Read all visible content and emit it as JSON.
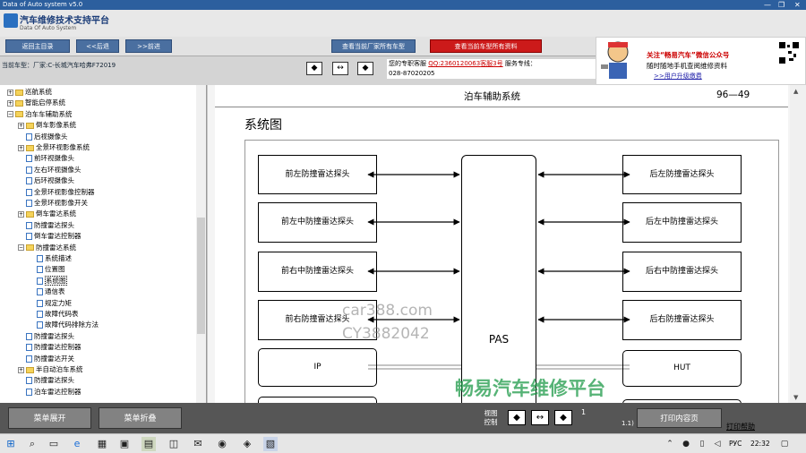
{
  "window": {
    "title": "Data of Auto system v5.0",
    "minimize": "—",
    "maximize": "❐",
    "close": "✕"
  },
  "header": {
    "app_title": "汽车维修技术支持平台",
    "app_subtitle": "Data Of Auto System"
  },
  "toolbar": {
    "back_main": "返回主目录",
    "prev": "<<后退",
    "next": ">>前进",
    "view_manufacturer_models": "查看当前厂家所有车型",
    "view_model_data": "查看当前车型所有资料"
  },
  "vehicle": {
    "label": "当前车型：厂家:C-长城汽车哈弗F72019"
  },
  "contact": {
    "prefix": "您的专职客服",
    "qq": "QQ:2360120063",
    "agent": "客服3号",
    "hotline_label": "服务专线：",
    "hotline": "028-87020205"
  },
  "ad": {
    "line1": "关注“畅易汽车”微信公众号",
    "line2": "随时随地手机查阅维修资料",
    "line3": ">>用户升级缴费"
  },
  "sidebar": {
    "items": [
      {
        "label": "巡航系统",
        "level": 0,
        "kind": "folder-exp"
      },
      {
        "label": "智能启停系统",
        "level": 0,
        "kind": "folder-exp"
      },
      {
        "label": "泊车车辅助系统",
        "level": 0,
        "kind": "folder-col"
      },
      {
        "label": "倒车影像系统",
        "level": 1,
        "kind": "folder-exp"
      },
      {
        "label": "后视摄像头",
        "level": 1,
        "kind": "doc"
      },
      {
        "label": "全景环视影像系统",
        "level": 1,
        "kind": "folder-exp"
      },
      {
        "label": "前环视摄像头",
        "level": 1,
        "kind": "doc"
      },
      {
        "label": "左右环视摄像头",
        "level": 1,
        "kind": "doc"
      },
      {
        "label": "后环视摄像头",
        "level": 1,
        "kind": "doc"
      },
      {
        "label": "全景环视影像控制器",
        "level": 1,
        "kind": "doc"
      },
      {
        "label": "全景环视影像开关",
        "level": 1,
        "kind": "doc"
      },
      {
        "label": "倒车雷达系统",
        "level": 1,
        "kind": "folder-exp"
      },
      {
        "label": "防撞雷达探头",
        "level": 1,
        "kind": "doc"
      },
      {
        "label": "倒车雷达控制器",
        "level": 1,
        "kind": "doc"
      },
      {
        "label": "防撞雷达系统",
        "level": 1,
        "kind": "folder-col"
      },
      {
        "label": "系统描述",
        "level": 2,
        "kind": "doc"
      },
      {
        "label": "位置图",
        "level": 2,
        "kind": "doc"
      },
      {
        "label": "系统图",
        "level": 2,
        "kind": "doc",
        "selected": true
      },
      {
        "label": "通信表",
        "level": 2,
        "kind": "doc"
      },
      {
        "label": "规定力矩",
        "level": 2,
        "kind": "doc"
      },
      {
        "label": "故障代码表",
        "level": 2,
        "kind": "doc"
      },
      {
        "label": "故障代码排除方法",
        "level": 2,
        "kind": "doc"
      },
      {
        "label": "防撞雷达探头",
        "level": 1,
        "kind": "doc"
      },
      {
        "label": "防撞雷达控制器",
        "level": 1,
        "kind": "doc"
      },
      {
        "label": "防撞雷达开关",
        "level": 1,
        "kind": "doc"
      },
      {
        "label": "半自动泊车系统",
        "level": 1,
        "kind": "folder-exp"
      },
      {
        "label": "防撞雷达探头",
        "level": 1,
        "kind": "doc"
      },
      {
        "label": "泊车雷达控制器",
        "level": 1,
        "kind": "doc"
      }
    ]
  },
  "document": {
    "section": "泊车辅助系统",
    "page_ref": "96—49",
    "heading": "系统图",
    "left_sensors": [
      "前左防撞雷达探头",
      "前左中防撞雷达探头",
      "前右中防撞雷达探头",
      "前右防撞雷达探头"
    ],
    "right_sensors": [
      "后左防撞雷达探头",
      "后左中防撞雷达探头",
      "后右中防撞雷达探头",
      "后右防撞雷达探头"
    ],
    "center": "PAS",
    "ip": "IP",
    "hut": "HUT",
    "watermark1": "car388.com",
    "watermark2": "CY3882042",
    "watermark3": "畅易汽车维修平台"
  },
  "bottom": {
    "expand": "菜单展开",
    "collapse": "菜单折叠",
    "view_control": "视图控制",
    "page_num": "1",
    "print": "打印内容页",
    "print_help": "打印帮助",
    "small_label": "1.1)"
  },
  "taskbar": {
    "language": "РУС",
    "time": "22:32"
  },
  "colors": {
    "accent": "#2c5f9e",
    "red_button": "#cc1a1a",
    "watermark_green": "#1e9a48"
  }
}
